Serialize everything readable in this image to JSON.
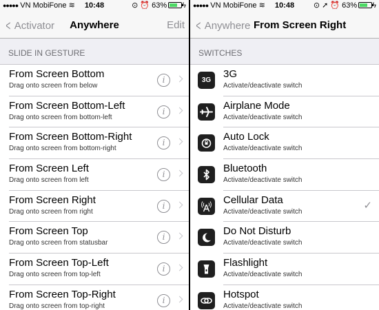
{
  "left": {
    "status": {
      "carrier": "VN MobiFone",
      "time": "10:48",
      "battery": "63%"
    },
    "nav": {
      "back_label": "Activator",
      "title": "Anywhere",
      "edit_label": "Edit"
    },
    "section_header": "SLIDE IN GESTURE",
    "items": [
      {
        "title": "From Screen Bottom",
        "subtitle": "Drag onto screen from below"
      },
      {
        "title": "From Screen Bottom-Left",
        "subtitle": "Drag onto screen from bottom-left"
      },
      {
        "title": "From Screen Bottom-Right",
        "subtitle": "Drag onto screen from bottom-right"
      },
      {
        "title": "From Screen Left",
        "subtitle": "Drag onto screen from left"
      },
      {
        "title": "From Screen Right",
        "subtitle": "Drag onto screen from right"
      },
      {
        "title": "From Screen Top",
        "subtitle": "Drag onto screen from statusbar"
      },
      {
        "title": "From Screen Top-Left",
        "subtitle": "Drag onto screen from top-left"
      },
      {
        "title": "From Screen Top-Right",
        "subtitle": "Drag onto screen from top-right"
      }
    ]
  },
  "right": {
    "status": {
      "carrier": "VN MobiFone",
      "time": "10:48",
      "battery": "63%"
    },
    "nav": {
      "back_label": "Anywhere",
      "title": "From Screen Right"
    },
    "section_header": "SWITCHES",
    "items": [
      {
        "title": "3G",
        "subtitle": "Activate/deactivate switch",
        "icon": "3g-icon",
        "icon_text": "3G",
        "checked": false
      },
      {
        "title": "Airplane Mode",
        "subtitle": "Activate/deactivate switch",
        "icon": "airplane-icon",
        "checked": false
      },
      {
        "title": "Auto Lock",
        "subtitle": "Activate/deactivate switch",
        "icon": "lock-icon",
        "checked": false
      },
      {
        "title": "Bluetooth",
        "subtitle": "Activate/deactivate switch",
        "icon": "bluetooth-icon",
        "checked": false
      },
      {
        "title": "Cellular Data",
        "subtitle": "Activate/deactivate switch",
        "icon": "cellular-icon",
        "checked": true
      },
      {
        "title": "Do Not Disturb",
        "subtitle": "Activate/deactivate switch",
        "icon": "moon-icon",
        "checked": false
      },
      {
        "title": "Flashlight",
        "subtitle": "Activate/deactivate switch",
        "icon": "flashlight-icon",
        "checked": false
      },
      {
        "title": "Hotspot",
        "subtitle": "Activate/deactivate switch",
        "icon": "hotspot-icon",
        "checked": false
      }
    ]
  },
  "colors": {
    "accent_gray": "#8e8e93",
    "battery_green": "#4cd964",
    "background": "#efeff4"
  }
}
